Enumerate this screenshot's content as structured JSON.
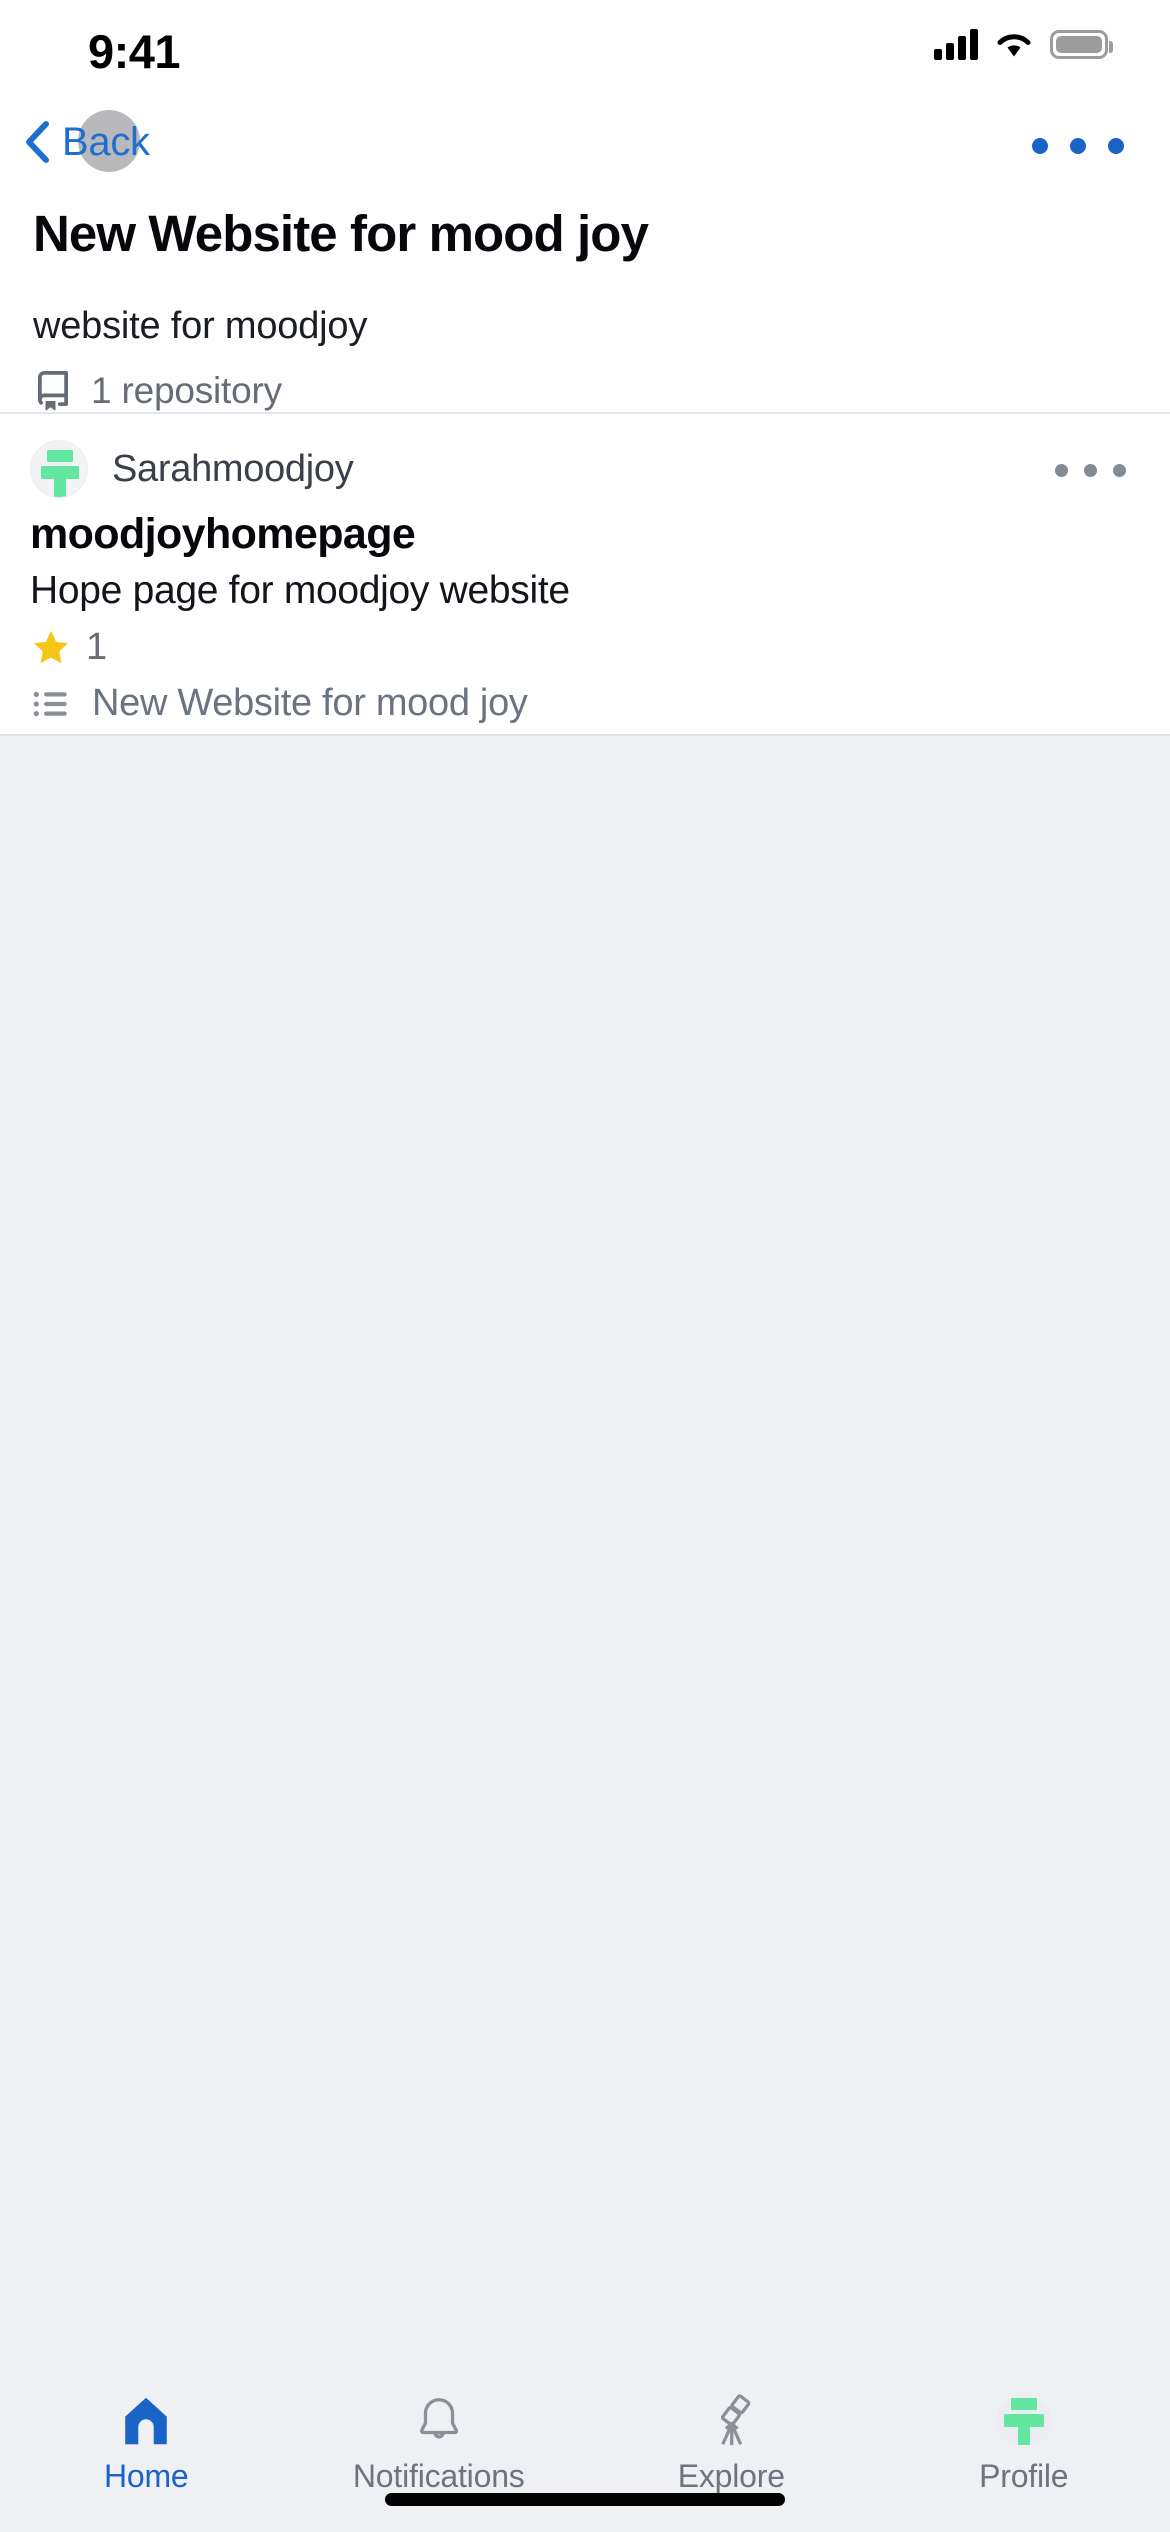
{
  "status_bar": {
    "time": "9:41",
    "signal_icon": "cellular-signal-icon",
    "wifi_icon": "wifi-icon",
    "battery_icon": "battery-full-icon"
  },
  "nav": {
    "back_label": "Back",
    "back_icon": "chevron-left-icon",
    "avatar_icon": "avatar-placeholder",
    "overflow_icon": "more-horizontal-icon",
    "overflow_color": "#1a64c8"
  },
  "project": {
    "title": "New Website for mood joy",
    "description": "website for moodjoy",
    "repo_icon": "repository-icon",
    "repo_count_label": "1 repository"
  },
  "repository": {
    "owner": "Sarahmoodjoy",
    "owner_avatar_icon": "user-avatar-icon",
    "overflow_icon": "more-horizontal-icon",
    "name": "moodjoyhomepage",
    "description": "Hope page for moodjoy website",
    "star_icon": "star-icon",
    "star_color": "#f5c518",
    "star_count": "1",
    "project_icon": "project-list-icon",
    "project_label": "New Website for mood joy"
  },
  "tabbar": {
    "items": [
      {
        "label": "Home",
        "icon": "home-icon",
        "active": true
      },
      {
        "label": "Notifications",
        "icon": "bell-icon",
        "active": false
      },
      {
        "label": "Explore",
        "icon": "telescope-icon",
        "active": false
      },
      {
        "label": "Profile",
        "icon": "profile-avatar-icon",
        "active": false
      }
    ],
    "active_color": "#1a64c8",
    "inactive_color": "#6e747e"
  },
  "home_indicator": "home-indicator-bar"
}
